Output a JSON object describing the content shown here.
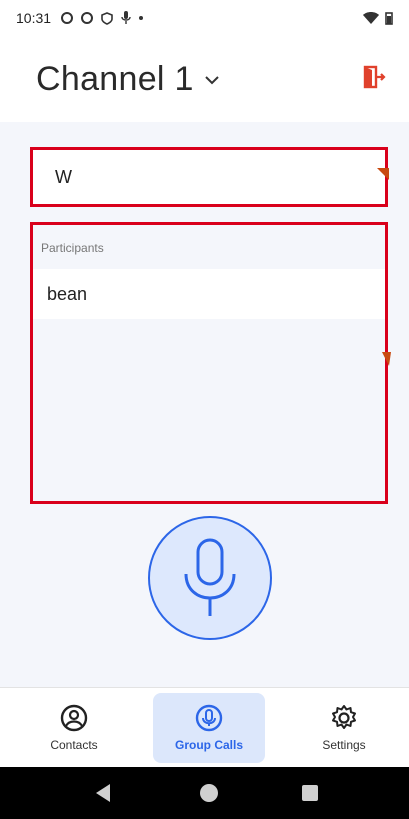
{
  "status_bar": {
    "time": "10:31"
  },
  "header": {
    "channel_title": "Channel 1"
  },
  "channel_input": {
    "value": "W"
  },
  "participants": {
    "label": "Participants",
    "items": [
      "bean"
    ]
  },
  "bottom_nav": {
    "items": [
      {
        "label": "Contacts",
        "icon": "person-circle-icon"
      },
      {
        "label": "Group Calls",
        "icon": "mic-circle-icon",
        "active": true
      },
      {
        "label": "Settings",
        "icon": "gear-icon"
      }
    ]
  },
  "colors": {
    "accent": "#2c66e8",
    "highlight_border": "#d9001b",
    "leave_icon": "#e0412c"
  }
}
